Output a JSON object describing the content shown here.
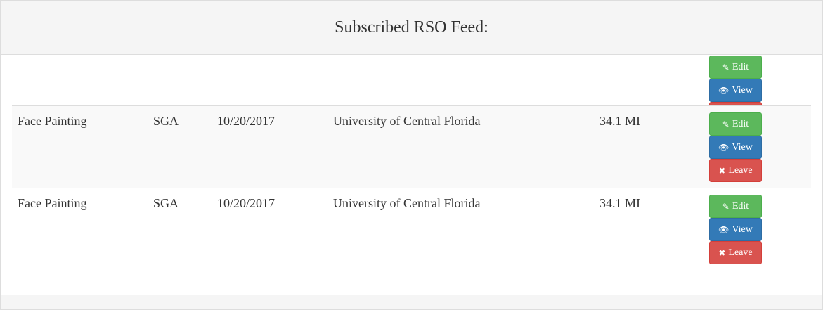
{
  "panel": {
    "title": "Subscribed RSO Feed:"
  },
  "buttons": {
    "edit": "Edit",
    "view": "View",
    "leave": "Leave"
  },
  "rows": [
    {
      "name": "",
      "org": "",
      "date": "",
      "location": "",
      "distance": ""
    },
    {
      "name": "Face Painting",
      "org": "SGA",
      "date": "10/20/2017",
      "location": "University of Central Florida",
      "distance": "34.1 MI"
    },
    {
      "name": "Face Painting",
      "org": "SGA",
      "date": "10/20/2017",
      "location": "University of Central Florida",
      "distance": "34.1 MI"
    }
  ],
  "colors": {
    "success": "#5cb85c",
    "primary": "#337ab7",
    "danger": "#d9534f",
    "heading_bg": "#f5f5f5"
  }
}
